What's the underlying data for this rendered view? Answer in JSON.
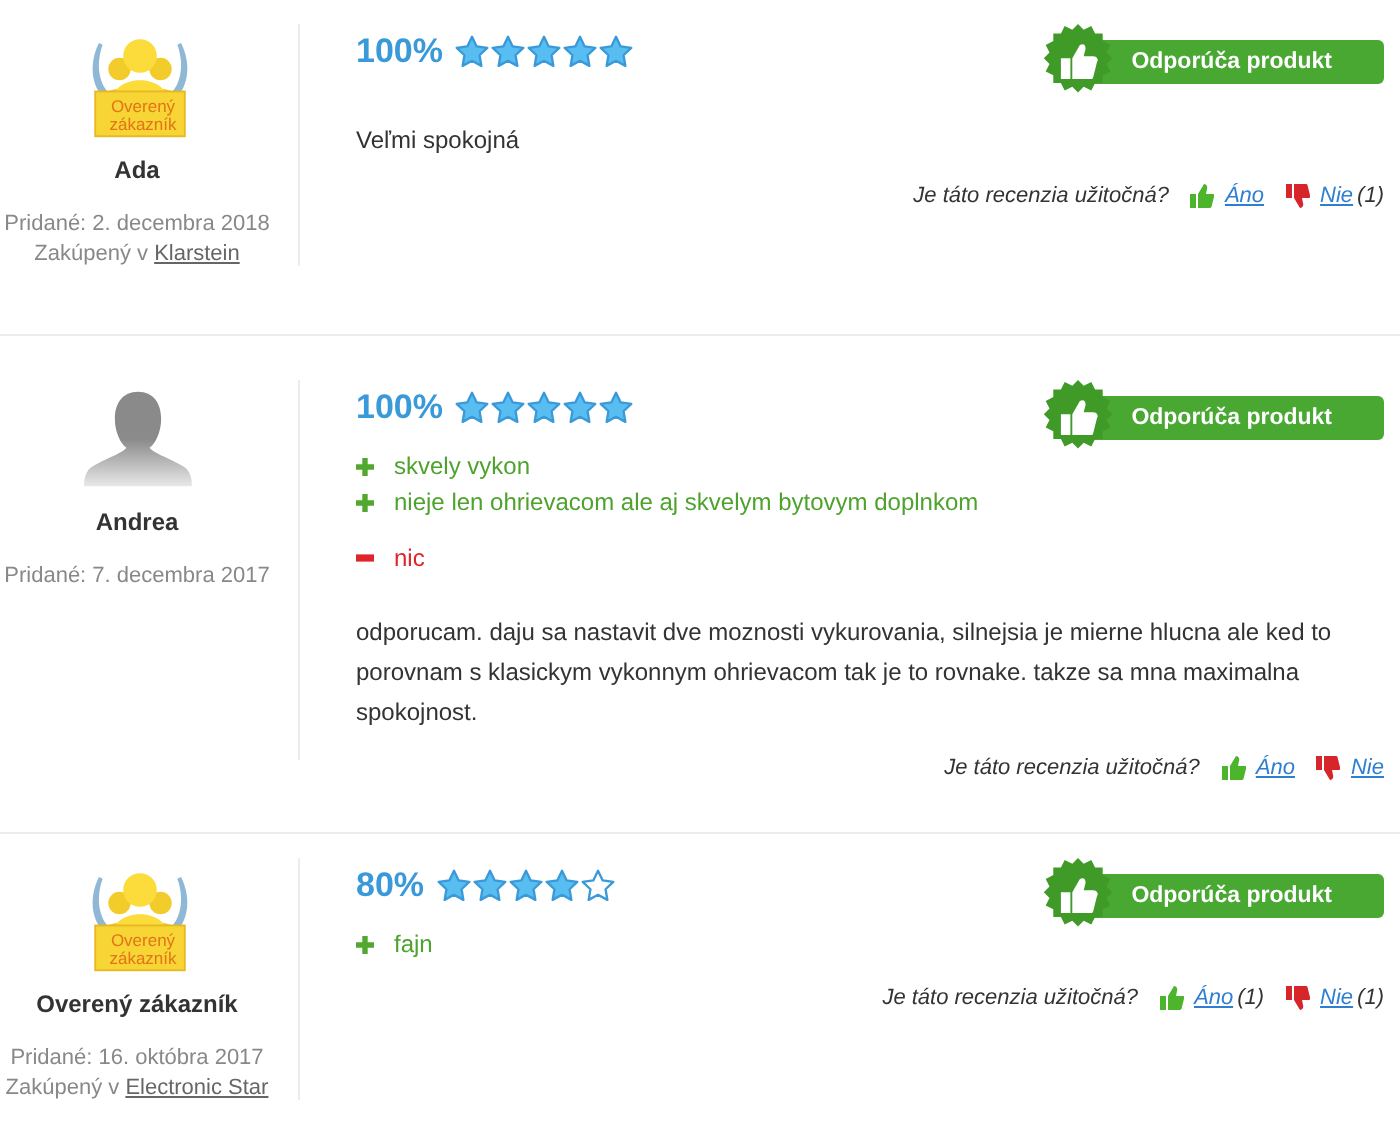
{
  "reviews": [
    {
      "avatar": {
        "kind": "verified",
        "label": "Overený zákazník"
      },
      "author": "Ada",
      "added": "Pridané: 2. decembra 2018",
      "purchased": {
        "prefix": "Zakúpený v",
        "shop": "Klarstein"
      },
      "score": "100%",
      "stars": 5,
      "recommend": "Odporúča produkt",
      "text": "Veľmi spokojná",
      "helpful": {
        "question": "Je táto recenzia užitočná?",
        "yes": "Áno",
        "no": "Nie",
        "no_count": "(1)"
      }
    },
    {
      "avatar": {
        "kind": "silhouette"
      },
      "author": "Andrea",
      "added": "Pridané: 7. decembra 2017",
      "score": "100%",
      "stars": 5,
      "recommend": "Odporúča produkt",
      "pros": [
        "skvely vykon",
        "nieje len ohrievacom ale aj skvelym bytovym doplnkom"
      ],
      "cons": [
        "nic"
      ],
      "text": "odporucam. daju sa nastavit dve moznosti vykurovania, silnejsia je mierne hlucna ale ked to porovnam s klasickym vykonnym ohrievacom tak je to rovnake. takze sa mna maximalna spokojnost.",
      "helpful": {
        "question": "Je táto recenzia užitočná?",
        "yes": "Áno",
        "no": "Nie"
      }
    },
    {
      "avatar": {
        "kind": "verified",
        "label": "Overený zákazník"
      },
      "author": "Overený zákazník",
      "added": "Pridané: 16. októbra 2017",
      "purchased": {
        "prefix": "Zakúpený v",
        "shop": "Electronic Star"
      },
      "score": "80%",
      "stars": 4,
      "recommend": "Odporúča produkt",
      "pros": [
        "fajn"
      ],
      "helpful": {
        "question": "Je táto recenzia užitočná?",
        "yes": "Áno",
        "yes_count": "(1)",
        "no": "Nie",
        "no_count": "(1)"
      }
    }
  ]
}
